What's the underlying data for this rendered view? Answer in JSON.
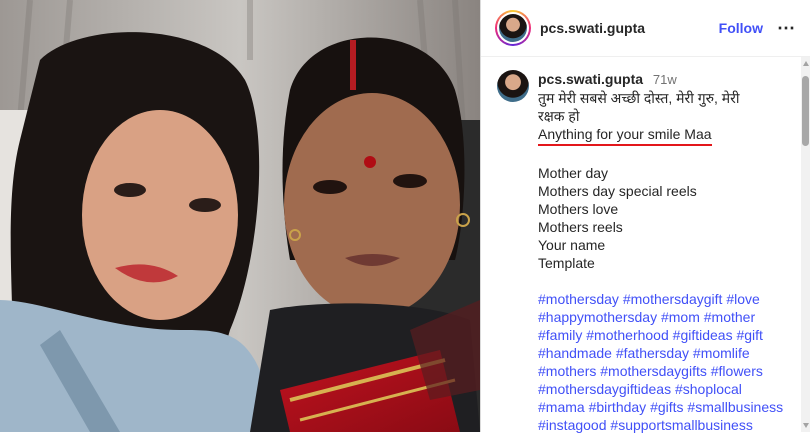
{
  "post": {
    "username": "pcs.swati.gupta",
    "follow_label": "Follow",
    "more_icon": "more-horizontal-icon",
    "photo_alt": "Two women selfie"
  },
  "caption": {
    "username": "pcs.swati.gupta",
    "time": "71w",
    "hindi_line_1": "तुम मेरी सबसे अच्छी दोस्त, मेरी गुरु, मेरी",
    "hindi_line_2": "रक्षक हो",
    "highlight": "Anything for your smile Maa",
    "lines": [
      "Mother day",
      "Mothers day special reels",
      "Mothers love",
      "Mothers reels",
      "Your name",
      "Template"
    ],
    "hashtag_rows": [
      [
        "#mothersday",
        "#mothersdaygift",
        "#love"
      ],
      [
        "#happymothersday",
        "#mom",
        "#mother"
      ],
      [
        "#family",
        "#motherhood",
        "#giftideas",
        "#gift"
      ],
      [
        "#handmade",
        "#fathersday",
        "#momlife"
      ],
      [
        "#mothers",
        "#mothersdaygifts",
        "#flowers"
      ],
      [
        "#mothersdaygiftideas",
        "#shoplocal"
      ],
      [
        "#mama",
        "#birthday",
        "#gifts",
        "#smallbusiness"
      ],
      [
        "#instagood",
        "#supportsmallbusiness"
      ]
    ]
  },
  "colors": {
    "link": "#4150f7",
    "underline": "#e3171b"
  }
}
